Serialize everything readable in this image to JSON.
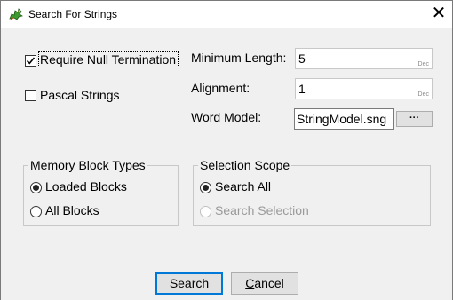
{
  "window": {
    "title": "Search For Strings",
    "close_glyph": "✕"
  },
  "options": {
    "require_null_label": "Require Null Termination",
    "require_null_checked": true,
    "pascal_label": "Pascal Strings",
    "pascal_checked": false
  },
  "params": {
    "min_length_label": "Minimum Length:",
    "min_length_value": "5",
    "min_length_unit": "Dec",
    "alignment_label": "Alignment:",
    "alignment_value": "1",
    "alignment_unit": "Dec",
    "word_model_label": "Word Model:",
    "word_model_value": "StringModel.sng",
    "browse_label": "···"
  },
  "memory_block_types": {
    "title": "Memory Block Types",
    "options": [
      {
        "label": "Loaded Blocks",
        "selected": true,
        "enabled": true
      },
      {
        "label": "All Blocks",
        "selected": false,
        "enabled": true
      }
    ]
  },
  "selection_scope": {
    "title": "Selection Scope",
    "options": [
      {
        "label": "Search All",
        "selected": true,
        "enabled": true
      },
      {
        "label": "Search Selection",
        "selected": false,
        "enabled": false
      }
    ]
  },
  "buttons": {
    "search_label": "Search",
    "cancel_label": "Cancel"
  },
  "icons": {
    "app_icon": "dragon-icon",
    "close": "close-icon"
  }
}
